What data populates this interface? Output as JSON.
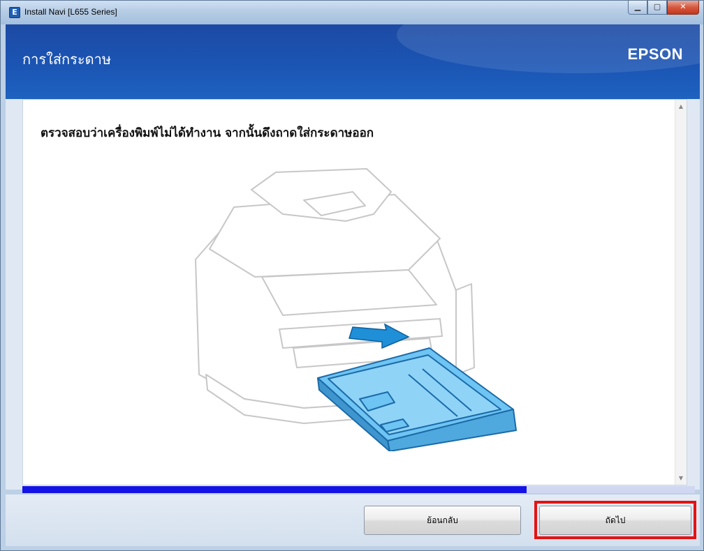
{
  "window": {
    "title": "Install Navi [L655 Series]",
    "app_icon_letter": "E"
  },
  "header": {
    "page_title": "การใส่กระดาษ",
    "brand": "EPSON"
  },
  "content": {
    "instruction": "ตรวจสอบว่าเครื่องพิมพ์ไม่ได้ทำงาน จากนั้นดึงถาดใส่กระดาษออก",
    "illustration": "printer-paper-tray-removal"
  },
  "progress": {
    "value": 0.75
  },
  "footer": {
    "back_label": "ย้อนกลับ",
    "next_label": "ถัดไป"
  },
  "colors": {
    "header_blue": "#1b55b4",
    "progress_fill": "#1313e6",
    "tray_blue": "#6ec4f2",
    "highlight_red": "#e41212"
  }
}
